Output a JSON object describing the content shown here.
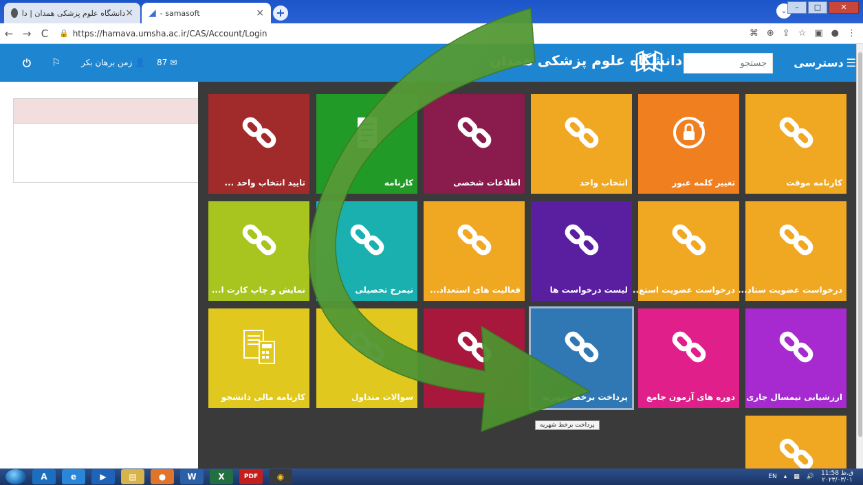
{
  "browser": {
    "tabs": [
      {
        "title": "دانشگاه علوم پزشکی همدان | دانشگاه علوم ...",
        "close": "×"
      },
      {
        "title": "- samasoft",
        "close": "×"
      }
    ],
    "new_tab": "+",
    "url": "https://hamava.umsha.ac.ir/CAS/Account/Login"
  },
  "header": {
    "message_count": "87",
    "user_name": "زمن برهان بکر",
    "site_title": "دانشگاه علوم پزشکی همدان",
    "search_placeholder": "جستجو",
    "access_label": "دسترسی"
  },
  "tiles": [
    {
      "label": "کارنامه موقت",
      "color": "#f0a823",
      "icon": "link-icon"
    },
    {
      "label": "تغییر کلمه عبور",
      "color": "#f07f1f",
      "icon": "lock-refresh-icon"
    },
    {
      "label": "انتخاب واحد",
      "color": "#f0a823",
      "icon": "link-icon"
    },
    {
      "label": "اطلاعات شخصی",
      "color": "#8a1c4d",
      "icon": "link-icon"
    },
    {
      "label": "کارنامه",
      "color": "#229a27",
      "icon": "document-icon"
    },
    {
      "label": "تایید انتخاب واحد ...",
      "color": "#a12b2b",
      "icon": "link-icon"
    },
    {
      "label": "درخواست عضویت ستاد...",
      "color": "#f0a823",
      "icon": "link-icon"
    },
    {
      "label": "درخواست عضویت استع...",
      "color": "#f0a823",
      "icon": "link-icon"
    },
    {
      "label": "لیست درخواست ها",
      "color": "#5a1ea0",
      "icon": "link-icon"
    },
    {
      "label": "فعالیت های استعداد...",
      "color": "#f0a823",
      "icon": "link-icon"
    },
    {
      "label": "نیمرخ تحصیلی",
      "color": "#1ab0b0",
      "icon": "link-icon"
    },
    {
      "label": "نمایش و چاپ کارت ا...",
      "color": "#a8c41f",
      "icon": "link-icon"
    },
    {
      "label": "ارزشیابی نیمسال جاری",
      "color": "#a62ad0",
      "icon": "link-icon"
    },
    {
      "label": "دوره های آزمون جامع",
      "color": "#e01f8a",
      "icon": "link-icon"
    },
    {
      "label": "پرداخت برخط شهریه",
      "color": "#2f78b3",
      "icon": "link-icon"
    },
    {
      "label": "",
      "color": "#a8173c",
      "icon": "link-icon"
    },
    {
      "label": "سوالات متداول",
      "color": "#e0c81f",
      "icon": "link-icon"
    },
    {
      "label": "کارنامه مالی دانشجو",
      "color": "#e0c81f",
      "icon": "calculator-icon"
    },
    {
      "label": "",
      "color": "#f0a823",
      "icon": "link-icon"
    }
  ],
  "tooltip": "پرداخت برخط شهریه",
  "taskbar": {
    "lang": "EN",
    "time": "11:58 ق.ظ",
    "date": "۲۰۲۳/۰۳/۰۱",
    "apps": [
      "W",
      "X",
      "PDF"
    ]
  }
}
